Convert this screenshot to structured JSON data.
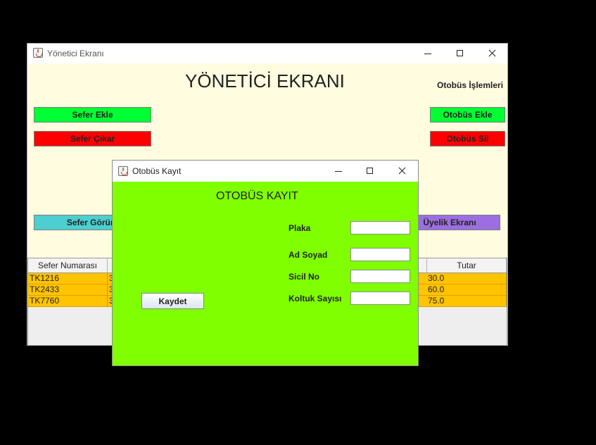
{
  "main_window": {
    "title": "Yönetici Ekranı",
    "heading": "YÖNETİCİ EKRANI",
    "section_label": "Otobüs İşlemleri",
    "buttons": {
      "add_trip": "Sefer Ekle",
      "remove_trip": "Sefer Çıkar",
      "view_trips": "Sefer Görünt",
      "add_bus": "Otobüs Ekle",
      "delete_bus": "Otobüs Sil",
      "membership": "Üyelik Ekranı"
    },
    "colors": {
      "background": "#fffce0",
      "add_trip": "#00ff33",
      "remove_trip": "#ff0000",
      "view_trips": "#4dcfd0",
      "add_bus": "#00ff33",
      "delete_bus": "#ff0000",
      "membership": "#9b6fe0",
      "table_row": "#ffc400"
    },
    "table": {
      "columns": [
        "Sefer Numarası",
        "Tutar"
      ],
      "rows": [
        {
          "trip_no": "TK1216",
          "partial": "3",
          "amount": "30.0"
        },
        {
          "trip_no": "TK2433",
          "partial": "3",
          "amount": "60.0"
        },
        {
          "trip_no": "TK7760",
          "partial": "3",
          "amount": "75.0"
        }
      ]
    }
  },
  "dialog": {
    "title": "Otobüs Kayıt",
    "heading": "OTOBÜS KAYIT",
    "background": "#7fff00",
    "fields": [
      {
        "label": "Plaka",
        "value": ""
      },
      {
        "label": "Ad Soyad",
        "value": ""
      },
      {
        "label": "Sicil No",
        "value": ""
      },
      {
        "label": "Koltuk Sayısı",
        "value": ""
      }
    ],
    "save_button": "Kaydet"
  }
}
